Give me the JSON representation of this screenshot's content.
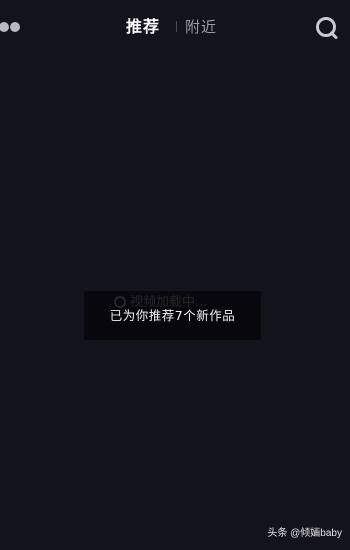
{
  "header": {
    "tabs": [
      {
        "label": "推荐",
        "active": true
      },
      {
        "label": "附近",
        "active": false
      }
    ],
    "left_icon": "more-dots-icon",
    "right_icon": "search-icon"
  },
  "toast": {
    "loading_text": "视频加载中...",
    "message": "已为你推荐7个新作品"
  },
  "watermark": {
    "text": "头条 @倾婳baby"
  },
  "colors": {
    "background": "#13131c",
    "toast_background": "#08080c",
    "active_tab": "#ffffff",
    "inactive_tab": "#9a9aa2"
  }
}
